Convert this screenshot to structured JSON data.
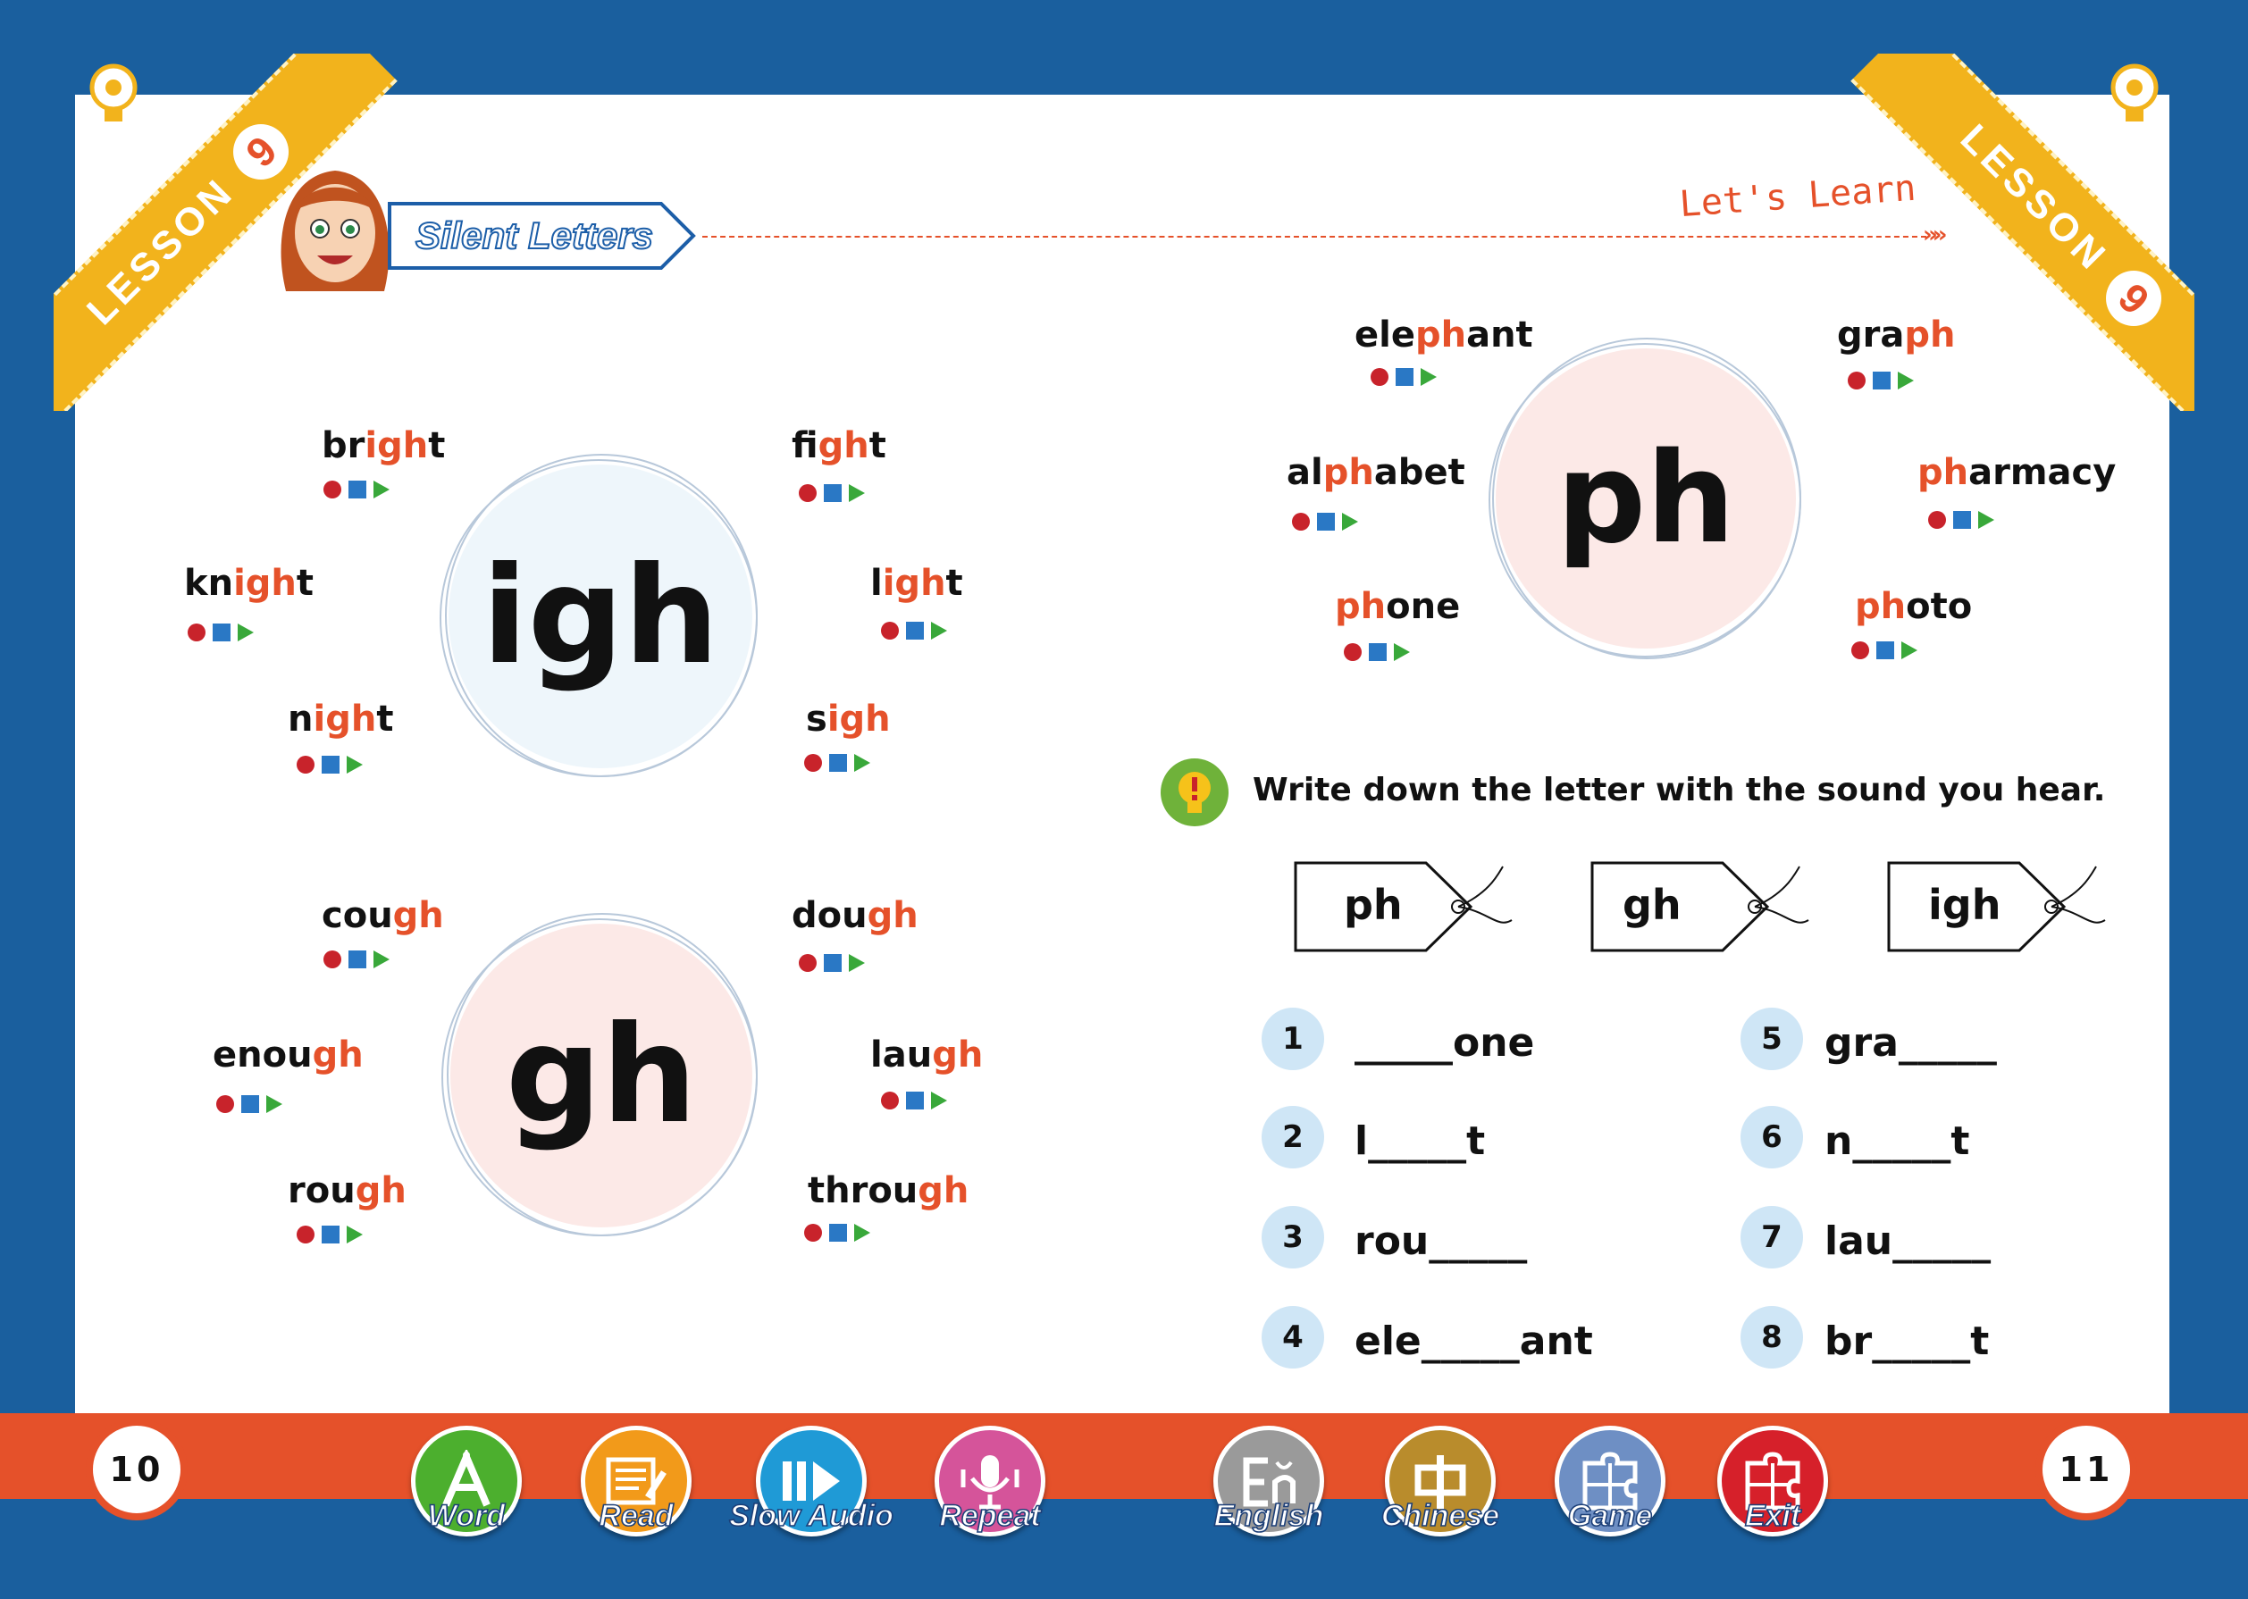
{
  "header": {
    "lesson_label": "LESSON",
    "lesson_number": "9",
    "section_title": "Silent Letters",
    "lets_learn": "Let's Learn",
    "chevrons": "»»"
  },
  "clusters": {
    "igh": {
      "label": "igh",
      "words": [
        {
          "pre": "br",
          "hl": "igh",
          "post": "t"
        },
        {
          "pre": "f",
          "hl": "igh",
          "post": "t"
        },
        {
          "pre": "kn",
          "hl": "igh",
          "post": "t"
        },
        {
          "pre": "l",
          "hl": "igh",
          "post": "t"
        },
        {
          "pre": "n",
          "hl": "igh",
          "post": "t"
        },
        {
          "pre": "s",
          "hl": "igh",
          "post": ""
        }
      ]
    },
    "gh": {
      "label": "gh",
      "words": [
        {
          "pre": "cou",
          "hl": "gh",
          "post": ""
        },
        {
          "pre": "dou",
          "hl": "gh",
          "post": ""
        },
        {
          "pre": "enou",
          "hl": "gh",
          "post": ""
        },
        {
          "pre": "lau",
          "hl": "gh",
          "post": ""
        },
        {
          "pre": "rou",
          "hl": "gh",
          "post": ""
        },
        {
          "pre": "throu",
          "hl": "gh",
          "post": ""
        }
      ]
    },
    "ph": {
      "label": "ph",
      "words": [
        {
          "pre": "ele",
          "hl": "ph",
          "post": "ant"
        },
        {
          "pre": "gra",
          "hl": "ph",
          "post": ""
        },
        {
          "pre": "al",
          "hl": "ph",
          "post": "abet"
        },
        {
          "pre": "",
          "hl": "ph",
          "post": "armacy"
        },
        {
          "pre": "",
          "hl": "ph",
          "post": "one"
        },
        {
          "pre": "",
          "hl": "ph",
          "post": "oto"
        }
      ]
    }
  },
  "exercise": {
    "instruction": "Write down the letter with the sound you hear.",
    "tags": [
      "ph",
      "gh",
      "igh"
    ],
    "questions": [
      {
        "num": "1",
        "text": "_____one"
      },
      {
        "num": "2",
        "text": "l_____t"
      },
      {
        "num": "3",
        "text": "rou_____"
      },
      {
        "num": "4",
        "text": "ele_____ant"
      },
      {
        "num": "5",
        "text": "gra_____"
      },
      {
        "num": "6",
        "text": "n_____t"
      },
      {
        "num": "7",
        "text": "lau_____"
      },
      {
        "num": "8",
        "text": "br_____t"
      }
    ]
  },
  "pages": {
    "left": "10",
    "right": "11"
  },
  "toolbar": [
    {
      "label": "Word",
      "icon": "letter-a-icon",
      "color": "#4caf2e"
    },
    {
      "label": "Read",
      "icon": "notebook-pencil-icon",
      "color": "#f29a1a"
    },
    {
      "label": "Slow Audio",
      "icon": "slow-play-icon",
      "color": "#1f9ad6"
    },
    {
      "label": "Repeat",
      "icon": "microphone-icon",
      "color": "#d5549a"
    },
    {
      "label": "English",
      "icon": "english-letter-icon",
      "color": "#9a9a9a"
    },
    {
      "label": "Chinese",
      "icon": "chinese-character-icon",
      "color": "#b98c2c"
    },
    {
      "label": "Game",
      "icon": "puzzle-icon",
      "color": "#6e8fc4"
    },
    {
      "label": "Exit",
      "icon": "puzzle-exit-icon",
      "color": "#d6202a"
    }
  ],
  "colors": {
    "frame": "#1a5f9e",
    "accent": "#e5512a",
    "ribbon": "#f2b31c",
    "page": "#ffffff"
  }
}
